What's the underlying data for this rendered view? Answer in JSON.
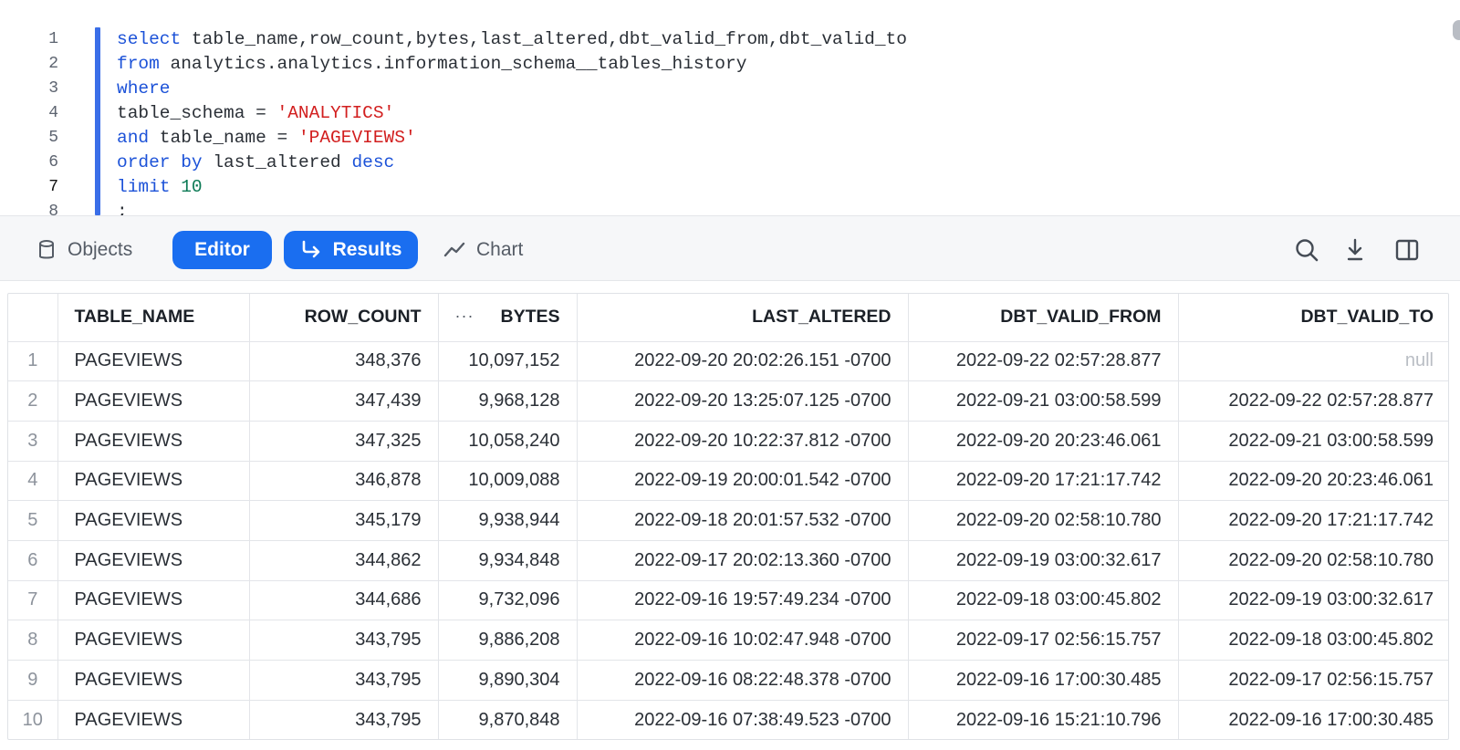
{
  "editor": {
    "line_numbers": [
      "1",
      "2",
      "3",
      "4",
      "5",
      "6",
      "7",
      "8"
    ],
    "lines": [
      [
        {
          "t": "select",
          "c": "kw"
        },
        {
          "t": " table_name,row_count,bytes,last_altered,dbt_valid_from,dbt_valid_to",
          "c": ""
        }
      ],
      [
        {
          "t": "from",
          "c": "kw"
        },
        {
          "t": " analytics.analytics.information_schema__tables_history",
          "c": ""
        }
      ],
      [
        {
          "t": "where",
          "c": "kw"
        }
      ],
      [
        {
          "t": "table_schema = ",
          "c": ""
        },
        {
          "t": "'ANALYTICS'",
          "c": "str"
        }
      ],
      [
        {
          "t": "and",
          "c": "kw"
        },
        {
          "t": " table_name = ",
          "c": ""
        },
        {
          "t": "'PAGEVIEWS'",
          "c": "str"
        }
      ],
      [
        {
          "t": "order by",
          "c": "kw"
        },
        {
          "t": " last_altered ",
          "c": ""
        },
        {
          "t": "desc",
          "c": "kw"
        }
      ],
      [
        {
          "t": "limit",
          "c": "kw"
        },
        {
          "t": " ",
          "c": ""
        },
        {
          "t": "10",
          "c": "num"
        }
      ],
      [
        {
          "t": ";",
          "c": ""
        }
      ]
    ]
  },
  "toolbar": {
    "objects_label": "Objects",
    "editor_label": "Editor",
    "results_label": "Results",
    "chart_label": "Chart"
  },
  "results": {
    "columns": [
      "TABLE_NAME",
      "ROW_COUNT",
      "BYTES",
      "LAST_ALTERED",
      "DBT_VALID_FROM",
      "DBT_VALID_TO"
    ],
    "column_menu": "···",
    "rows": [
      [
        "1",
        "PAGEVIEWS",
        "348,376",
        "10,097,152",
        "2022-09-20 20:02:26.151 -0700",
        "2022-09-22 02:57:28.877",
        "null"
      ],
      [
        "2",
        "PAGEVIEWS",
        "347,439",
        "9,968,128",
        "2022-09-20 13:25:07.125 -0700",
        "2022-09-21 03:00:58.599",
        "2022-09-22 02:57:28.877"
      ],
      [
        "3",
        "PAGEVIEWS",
        "347,325",
        "10,058,240",
        "2022-09-20 10:22:37.812 -0700",
        "2022-09-20 20:23:46.061",
        "2022-09-21 03:00:58.599"
      ],
      [
        "4",
        "PAGEVIEWS",
        "346,878",
        "10,009,088",
        "2022-09-19 20:00:01.542 -0700",
        "2022-09-20 17:21:17.742",
        "2022-09-20 20:23:46.061"
      ],
      [
        "5",
        "PAGEVIEWS",
        "345,179",
        "9,938,944",
        "2022-09-18 20:01:57.532 -0700",
        "2022-09-20 02:58:10.780",
        "2022-09-20 17:21:17.742"
      ],
      [
        "6",
        "PAGEVIEWS",
        "344,862",
        "9,934,848",
        "2022-09-17 20:02:13.360 -0700",
        "2022-09-19 03:00:32.617",
        "2022-09-20 02:58:10.780"
      ],
      [
        "7",
        "PAGEVIEWS",
        "344,686",
        "9,732,096",
        "2022-09-16 19:57:49.234 -0700",
        "2022-09-18 03:00:45.802",
        "2022-09-19 03:00:32.617"
      ],
      [
        "8",
        "PAGEVIEWS",
        "343,795",
        "9,886,208",
        "2022-09-16 10:02:47.948 -0700",
        "2022-09-17 02:56:15.757",
        "2022-09-18 03:00:45.802"
      ],
      [
        "9",
        "PAGEVIEWS",
        "343,795",
        "9,890,304",
        "2022-09-16 08:22:48.378 -0700",
        "2022-09-16 17:00:30.485",
        "2022-09-17 02:56:15.757"
      ],
      [
        "10",
        "PAGEVIEWS",
        "343,795",
        "9,870,848",
        "2022-09-16 07:38:49.523 -0700",
        "2022-09-16 15:21:10.796",
        "2022-09-16 17:00:30.485"
      ]
    ]
  },
  "colors": {
    "accent": "#1a6ef0",
    "keyword": "#1c52d8",
    "string": "#d21f1f",
    "number": "#0c7a55"
  }
}
